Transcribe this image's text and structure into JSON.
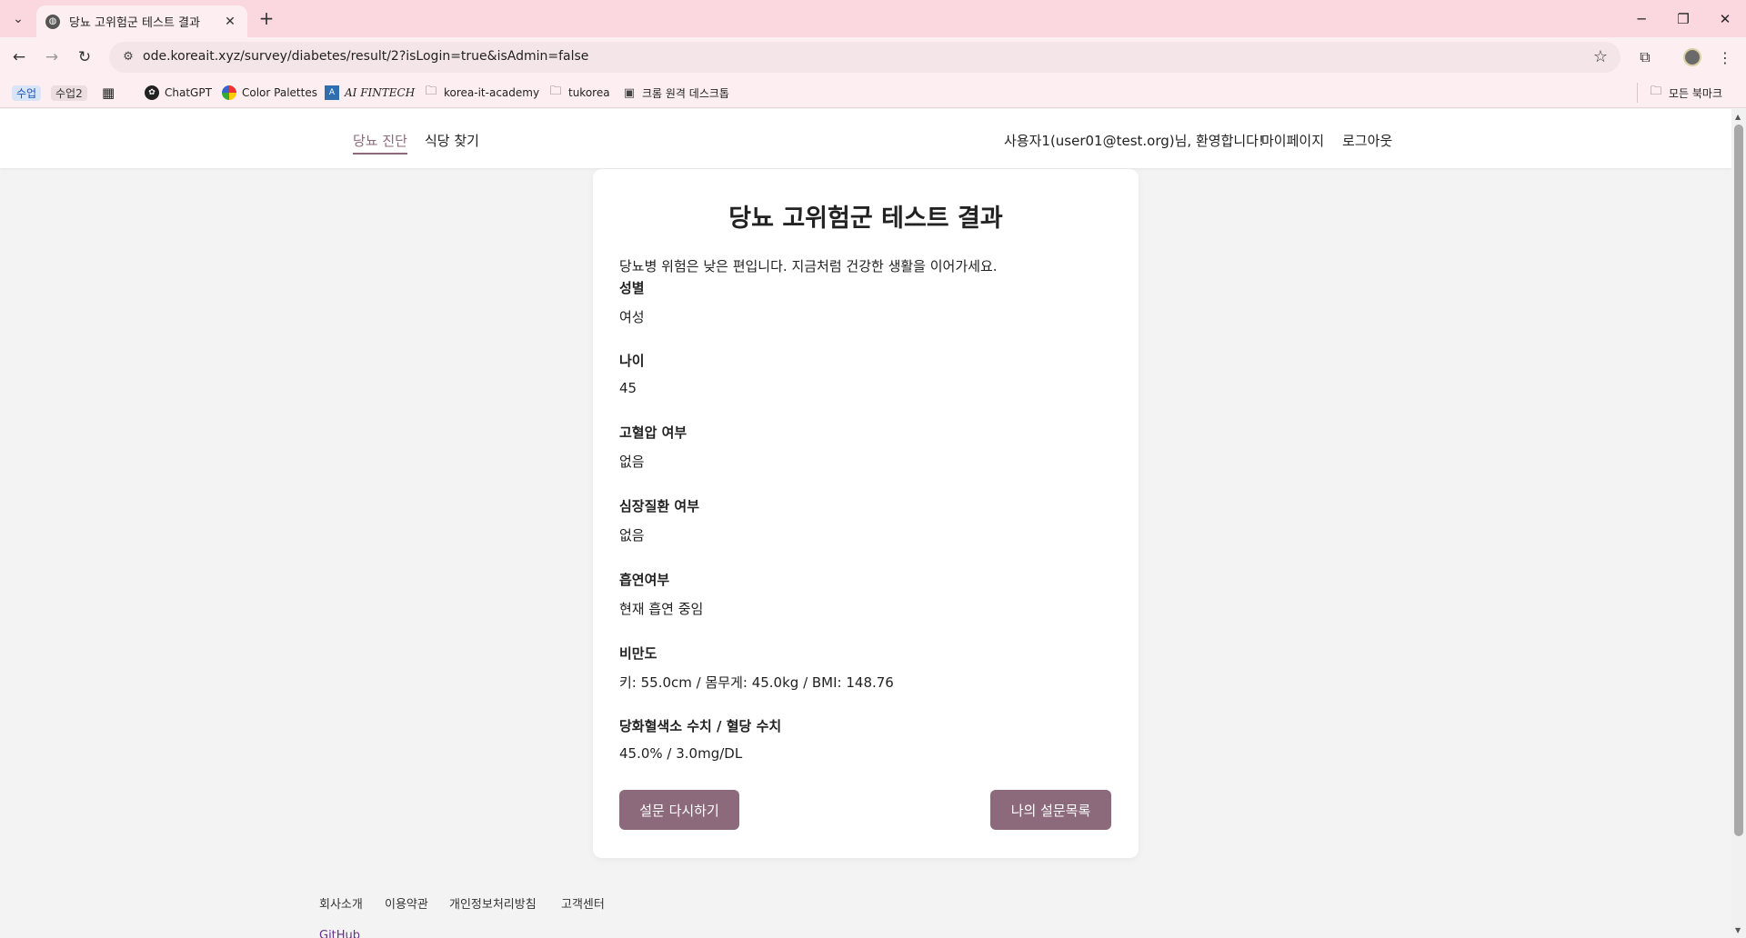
{
  "browser": {
    "tab_title": "당뇨 고위험군 테스트 결과",
    "url": "ode.koreait.xyz/survey/diabetes/result/2?isLogin=true&isAdmin=false",
    "bookmarks": {
      "b1": "수업",
      "b2": "수업2",
      "b3": "ChatGPT",
      "b4": "Color Palettes",
      "b5": "AI FINTECH",
      "b6": "korea-it-academy",
      "b7": "tukorea",
      "b8": "크롬 원격 데스크톱",
      "all": "모든 북마크"
    }
  },
  "nav": {
    "left1": "당뇨 진단",
    "left2": "식당 찾기",
    "welcome": "사용자1(user01@test.org)님, 환영합니다!",
    "mypage": "마이페이지",
    "logout": "로그아웃"
  },
  "result": {
    "title": "당뇨 고위험군 테스트 결과",
    "summary": "당뇨병 위험은 낮은 편입니다. 지금처럼 건강한 생활을 이어가세요.",
    "fields": [
      {
        "label": "성별",
        "value": "여성"
      },
      {
        "label": "나이",
        "value": "45"
      },
      {
        "label": "고혈압 여부",
        "value": "없음"
      },
      {
        "label": "심장질환 여부",
        "value": "없음"
      },
      {
        "label": "흡연여부",
        "value": "현재 흡연 중임"
      },
      {
        "label": "비만도",
        "value": "키: 55.0cm / 몸무게: 45.0kg / BMI: 148.76"
      },
      {
        "label": "당화혈색소 수치 / 혈당 수치",
        "value": "45.0% / 3.0mg/DL"
      }
    ],
    "retry_button": "설문 다시하기",
    "list_button": "나의 설문목록"
  },
  "footer": {
    "about": "회사소개",
    "terms": "이용약관",
    "privacy": "개인정보처리방침",
    "support": "고객센터",
    "github": "GitHub"
  },
  "colors": {
    "accent": "#8d6a7b",
    "chrome": "#fbd7df"
  }
}
